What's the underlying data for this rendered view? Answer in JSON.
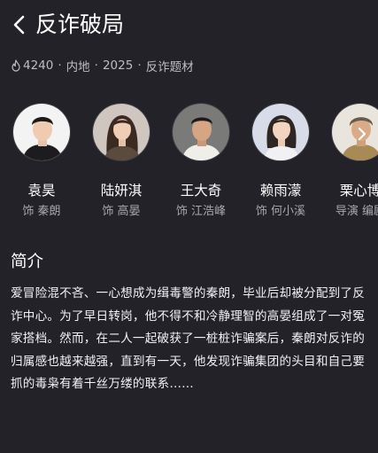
{
  "header": {
    "title": "反诈破局"
  },
  "meta": {
    "heat": "4240",
    "region": "内地",
    "year": "2025",
    "genre": "反诈题材",
    "separator": "·"
  },
  "cast": [
    {
      "name": "袁昊",
      "role": "饰 秦朗"
    },
    {
      "name": "陆妍淇",
      "role": "饰 高晏"
    },
    {
      "name": "王大奇",
      "role": "饰 江浩峰"
    },
    {
      "name": "赖雨濛",
      "role": "饰 何小溪"
    },
    {
      "name": "栗心博",
      "role": "导演 编剧"
    }
  ],
  "synopsis": {
    "title": "简介",
    "text": "爱冒险混不吝、一心想成为缉毒警的秦朗，毕业后却被分配到了反诈中心。为了早日转岗，他不得不和冷静理智的高晏组成了一对冤家搭档。然而，在二人一起破获了一桩桩诈骗案后，秦朗对反诈的归属感也越来越强，直到有一天，他发现诈骗集团的头目和自己要抓的毒枭有着千丝万缕的联系……"
  },
  "colors": {
    "background": "#232228",
    "text_primary": "#ffffff",
    "text_secondary": "#a8a7ad"
  },
  "icons": {
    "back": "chevron-left-icon",
    "heat": "flame-icon",
    "scroll": "chevron-right-icon"
  }
}
